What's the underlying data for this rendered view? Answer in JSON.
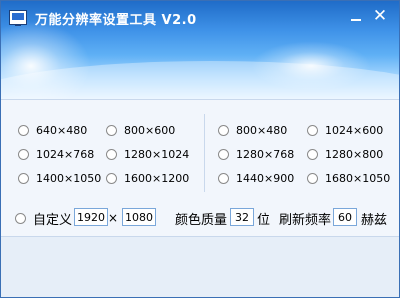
{
  "window": {
    "title": "万能分辨率设置工具 V2.0",
    "minimize_icon": "minimize-icon",
    "close_symbol": "✕",
    "accent_color": "#3f92e8"
  },
  "resolutions": {
    "left": [
      [
        "640×480",
        "800×600"
      ],
      [
        "1024×768",
        "1280×1024"
      ],
      [
        "1400×1050",
        "1600×1200"
      ]
    ],
    "right": [
      [
        "800×480",
        "1024×600"
      ],
      [
        "1280×768",
        "1280×800"
      ],
      [
        "1440×900",
        "1680×1050"
      ]
    ]
  },
  "custom": {
    "label": "自定义",
    "width": "1920",
    "times": "×",
    "height": "1080",
    "color_depth_label": "颜色质量",
    "color_depth": "32",
    "color_depth_unit": "位",
    "refresh_label": "刷新频率",
    "refresh": "60",
    "refresh_unit": "赫兹"
  }
}
